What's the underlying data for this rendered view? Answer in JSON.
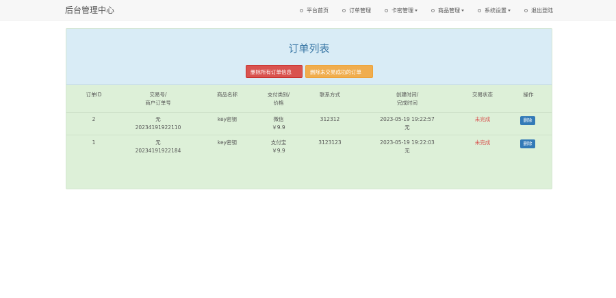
{
  "navbar": {
    "brand": "后台管理中心",
    "items": [
      {
        "label": "平台首页",
        "dropdown": false
      },
      {
        "label": "订单管理",
        "dropdown": false
      },
      {
        "label": "卡密管理",
        "dropdown": true
      },
      {
        "label": "商品管理",
        "dropdown": true
      },
      {
        "label": "系统设置",
        "dropdown": true
      },
      {
        "label": "退出登陆",
        "dropdown": false
      }
    ]
  },
  "panel": {
    "title": "订单列表",
    "delete_all_label": "删除所有订单信息",
    "delete_unfinished_label": "删除未交易成功的订单"
  },
  "table": {
    "headers": {
      "id": "订单ID",
      "trade_no_1": "交易号/",
      "trade_no_2": "商户订单号",
      "product": "商品名称",
      "pay_1": "支付类别/",
      "pay_2": "价格",
      "contact": "联系方式",
      "time_1": "创建时间/",
      "time_2": "完成时间",
      "status": "交易状态",
      "action": "操作"
    },
    "rows": [
      {
        "id": "2",
        "trade_no": "无",
        "merchant_no": "20234191922110",
        "product": "key密钥",
        "pay_type": "微信",
        "price": "￥9.9",
        "contact": "312312",
        "create_time": "2023-05-19 19:22:57",
        "finish_time": "无",
        "status": "未完成",
        "action": "删除"
      },
      {
        "id": "1",
        "trade_no": "无",
        "merchant_no": "20234191922184",
        "product": "key密钥",
        "pay_type": "支付宝",
        "price": "￥9.9",
        "contact": "3123123",
        "create_time": "2023-05-19 19:22:03",
        "finish_time": "无",
        "status": "未完成",
        "action": "删除"
      }
    ]
  },
  "colors": {
    "status_unfinished": "#d9534f",
    "action_button": "#337ab7",
    "delete_all_button": "#d9534f",
    "delete_unfinished_button": "#f0ad4e"
  }
}
